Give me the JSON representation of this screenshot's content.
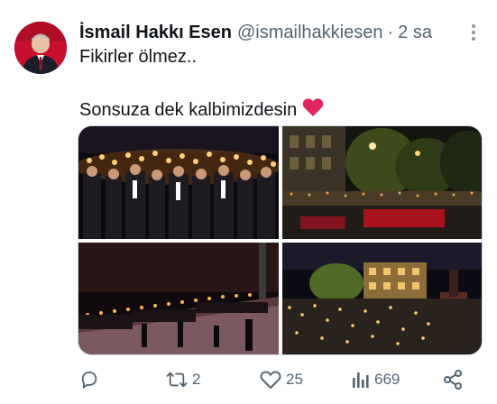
{
  "author": {
    "display_name": "İsmail Hakkı Esen",
    "handle": "@ismailhakkiesen",
    "separator": "·",
    "time": "2 sa"
  },
  "tweet": {
    "line1": "Fikirler ölmez..",
    "line2": "Sonsuza dek kalbimizdesin",
    "emoji": "red-heart-icon"
  },
  "media": {
    "photos": [
      "torch-march-crowd-photo",
      "square-night-crowd-photo",
      "torch-procession-photo",
      "illuminated-square-photo"
    ]
  },
  "actions": {
    "reply_count": "",
    "retweet_count": "2",
    "like_count": "25",
    "view_count": "669"
  },
  "colors": {
    "text": "#0f1419",
    "secondary": "#536471",
    "heart": "#e0245e"
  }
}
